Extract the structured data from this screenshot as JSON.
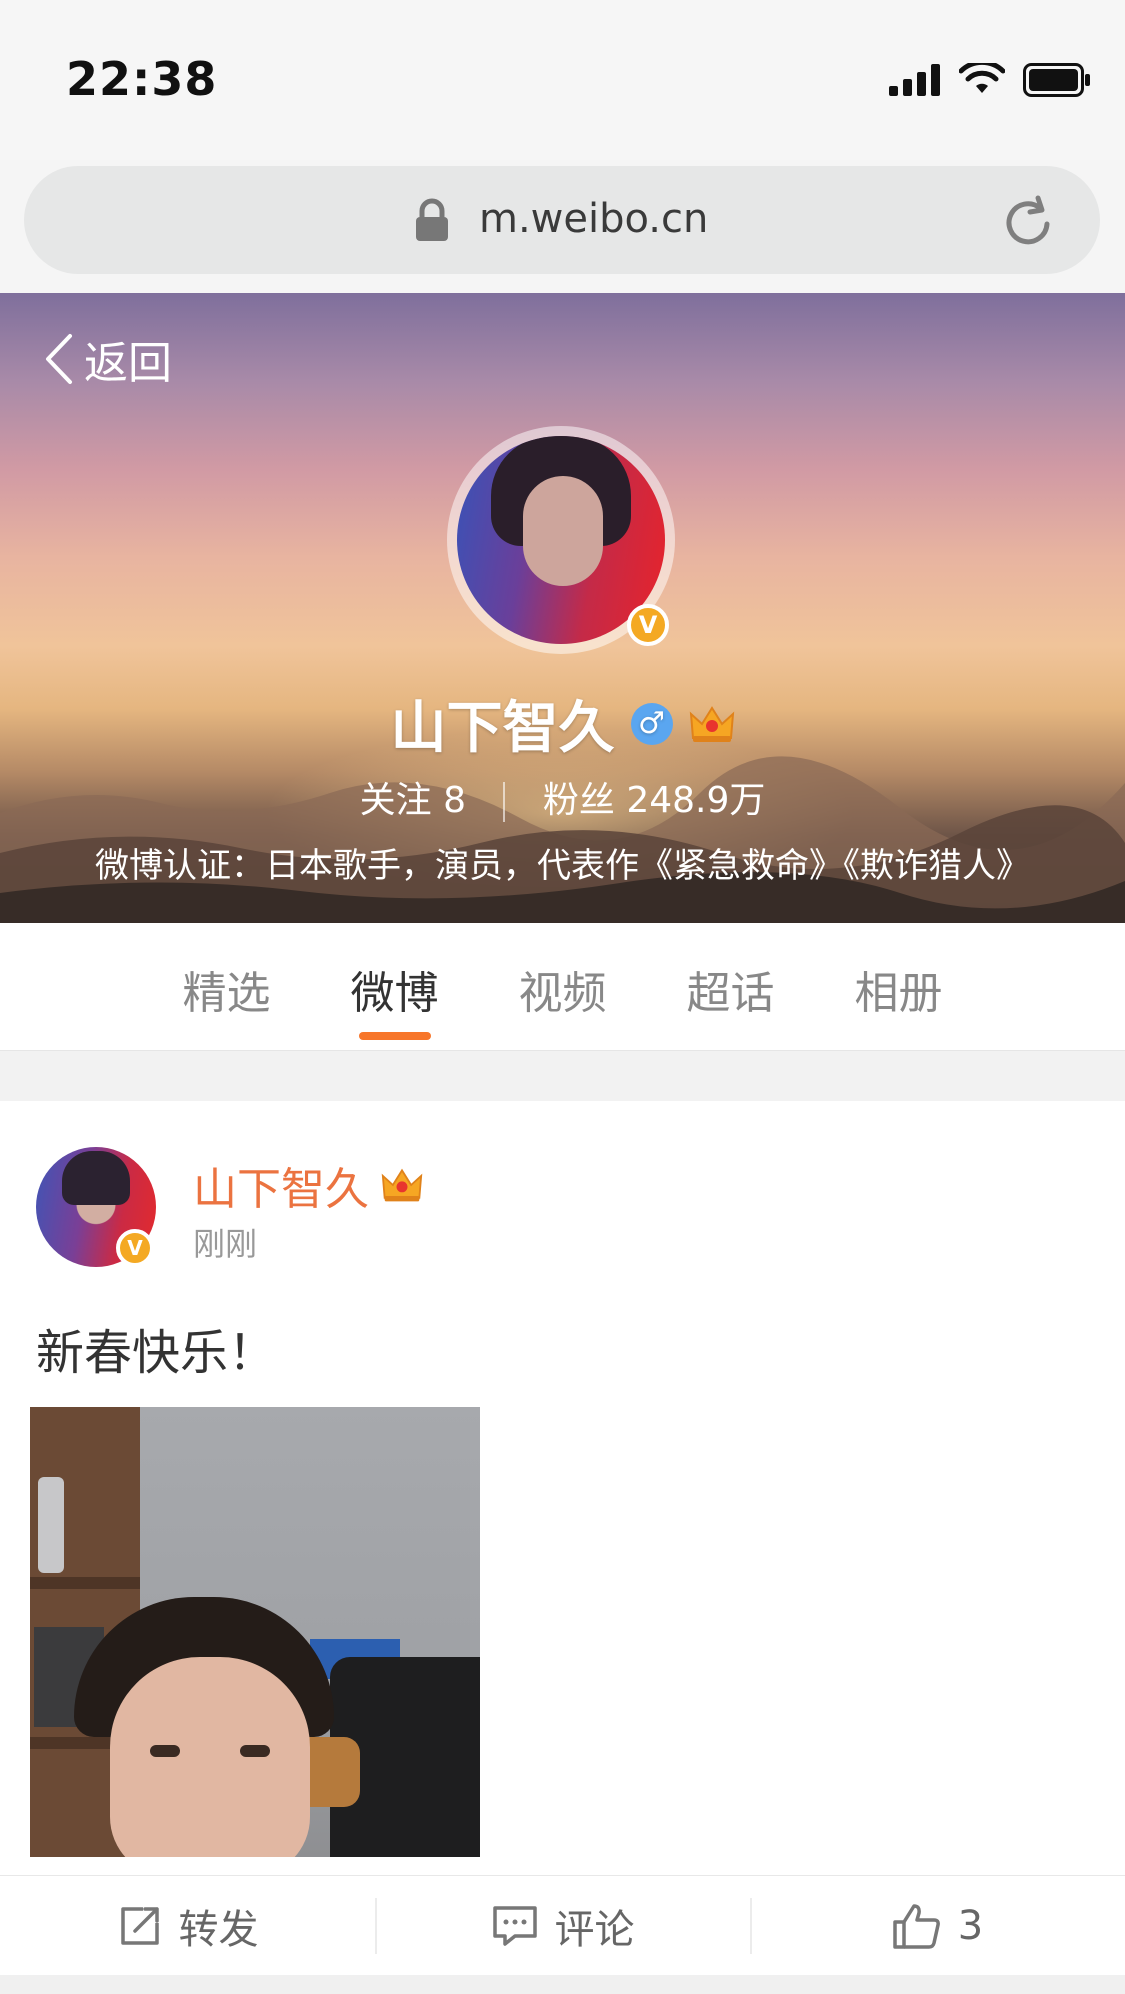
{
  "status_bar": {
    "time": "22:38"
  },
  "browser": {
    "url": "m.weibo.cn"
  },
  "profile": {
    "back_label": "返回",
    "name": "山下智久",
    "gender_symbol": "♂",
    "verified_badge": "V",
    "following_label": "关注",
    "following_count": "8",
    "followers_label": "粉丝",
    "followers_count": "248.9万",
    "verification": "微博认证：日本歌手，演员，代表作《紧急救命》《欺诈猎人》"
  },
  "tabs": [
    {
      "label": "精选",
      "active": false
    },
    {
      "label": "微博",
      "active": true
    },
    {
      "label": "视频",
      "active": false
    },
    {
      "label": "超话",
      "active": false
    },
    {
      "label": "相册",
      "active": false
    }
  ],
  "post": {
    "author": "山下智久",
    "verified_badge": "V",
    "time": "刚刚",
    "text": "新春快乐！"
  },
  "actions": {
    "repost_label": "转发",
    "comment_label": "评论",
    "like_count": "3"
  },
  "colors": {
    "accent": "#f7762a",
    "author_name": "#eb7340",
    "verified": "#f4a923",
    "gender_male": "#5aa6f0"
  }
}
